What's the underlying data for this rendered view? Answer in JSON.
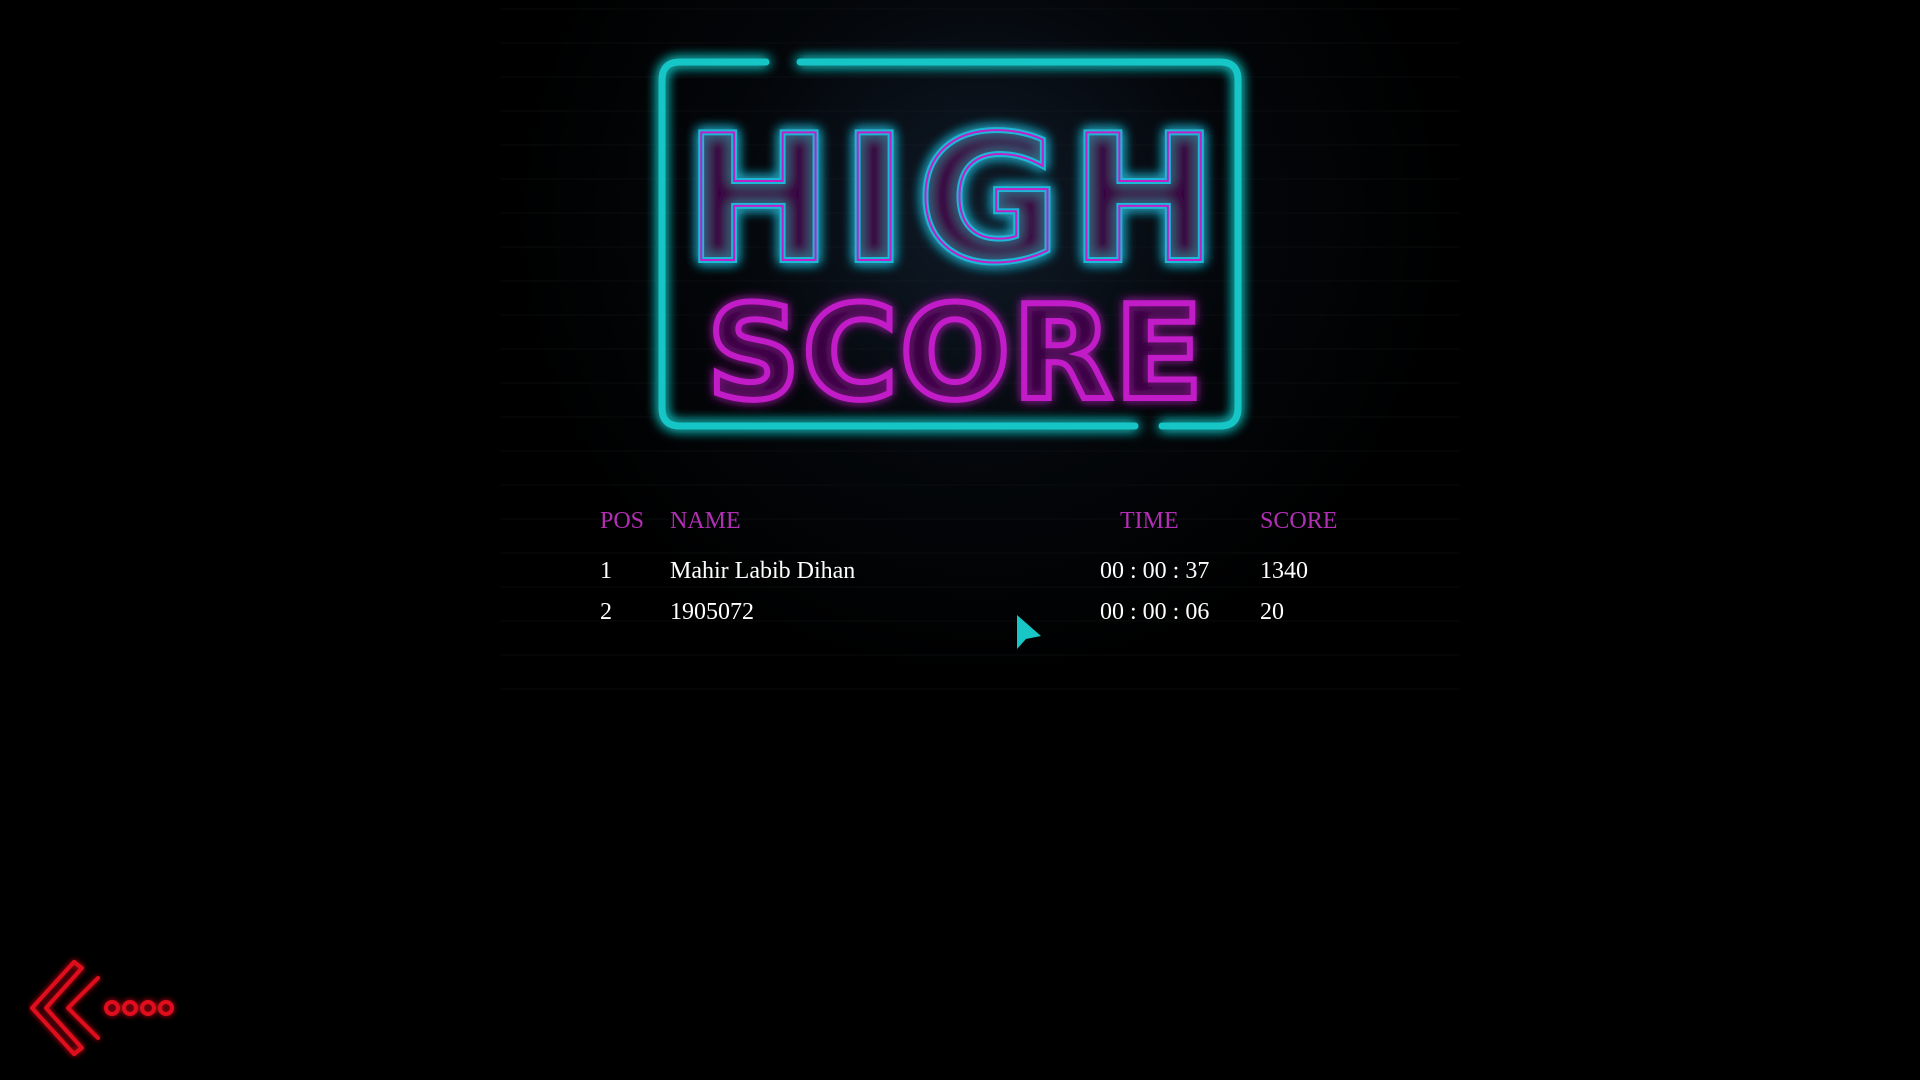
{
  "sign": {
    "line1": "HIGH",
    "line2": "SCORE"
  },
  "table": {
    "headers": {
      "pos": "POS",
      "name": "NAME",
      "time": "TIME",
      "score": "SCORE"
    },
    "rows": [
      {
        "pos": "1",
        "name": "Mahir Labib Dihan",
        "time": "00 : 00 : 37",
        "score": "1340"
      },
      {
        "pos": "2",
        "name": "1905072",
        "time": "00 : 00 : 06",
        "score": "20"
      }
    ]
  },
  "icons": {
    "cursor": "arrow-cursor-icon",
    "back": "back-arrow-icon"
  },
  "colors": {
    "background": "#000000",
    "header_text": "#b12fb4",
    "row_text": "#ffffff",
    "neon_cyan": "#19c6c6",
    "neon_magenta": "#c21fc8",
    "neon_red": "#e0101a"
  }
}
